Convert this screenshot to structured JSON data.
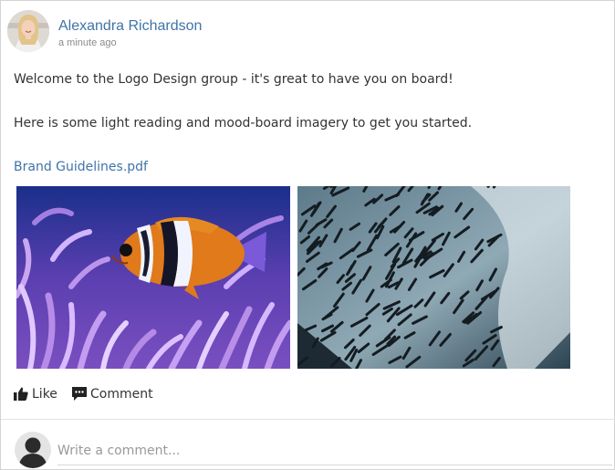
{
  "post": {
    "author": "Alexandra Richardson",
    "timestamp": "a minute ago",
    "paragraphs": [
      "Welcome to the Logo Design group - it's great to have you on board!",
      "Here is some light reading and mood-board imagery to get you started."
    ],
    "attachment": "Brand Guidelines.pdf"
  },
  "actions": {
    "like_label": "Like",
    "comment_label": "Comment"
  },
  "comment_box": {
    "placeholder": "Write a comment..."
  },
  "colors": {
    "link": "#3f74a8",
    "text": "#333333",
    "muted": "#8a8a8a",
    "border": "#d4d4d4"
  },
  "icons": [
    "thumbs-up-icon",
    "comment-icon",
    "user-silhouette-icon"
  ]
}
